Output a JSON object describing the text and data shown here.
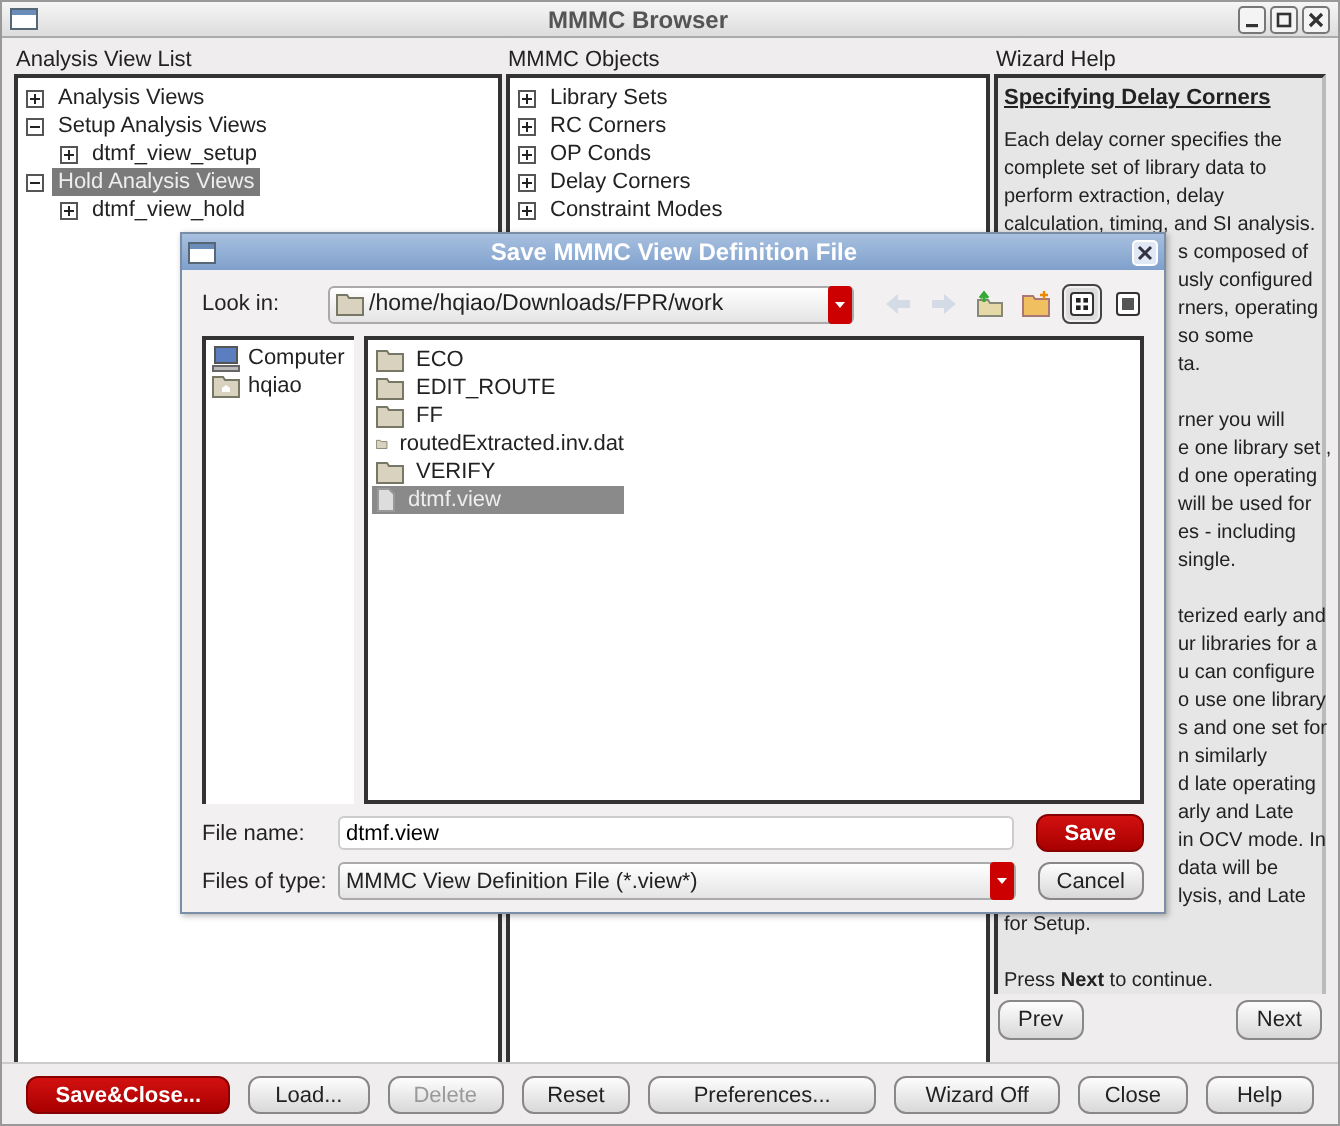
{
  "window": {
    "title": "MMMC Browser"
  },
  "analysis_view_list": {
    "label": "Analysis View List",
    "items": [
      {
        "label": "Analysis Views",
        "expanded": false,
        "selected": false
      },
      {
        "label": "Setup Analysis Views",
        "expanded": true,
        "selected": false,
        "children": [
          {
            "label": "dtmf_view_setup",
            "expanded": false,
            "selected": false
          }
        ]
      },
      {
        "label": "Hold Analysis Views",
        "expanded": true,
        "selected": true,
        "children": [
          {
            "label": "dtmf_view_hold",
            "expanded": false,
            "selected": false
          }
        ]
      }
    ]
  },
  "mmmc_objects": {
    "label": "MMMC Objects",
    "items": [
      {
        "label": "Library Sets",
        "expanded": false
      },
      {
        "label": "RC Corners",
        "expanded": false
      },
      {
        "label": "OP Conds",
        "expanded": false
      },
      {
        "label": "Delay Corners",
        "expanded": false
      },
      {
        "label": "Constraint Modes",
        "expanded": false
      }
    ]
  },
  "wizard_help": {
    "label": "Wizard Help",
    "heading": "Specifying Delay Corners",
    "paragraphs": [
      {
        "lines": [
          {
            "text": "Each delay corner specifies the",
            "kind": "full"
          },
          {
            "text": "complete set of library data to",
            "kind": "full"
          },
          {
            "text": "perform extraction, delay",
            "kind": "full"
          },
          {
            "text": "calculation, timing, and SI analysis.",
            "kind": "full"
          },
          {
            "text": "s composed of",
            "kind": "clipped"
          },
          {
            "text": "usly configured",
            "kind": "clipped"
          },
          {
            "text": "rners, operating",
            "kind": "clipped"
          },
          {
            "text": "so some",
            "kind": "clipped"
          },
          {
            "text": "ta.",
            "kind": "clipped"
          }
        ]
      },
      {
        "lines": [
          {
            "text": "rner you will",
            "kind": "clipped"
          },
          {
            "text": "e one library set ,",
            "kind": "clipped"
          },
          {
            "text": "d one operating",
            "kind": "clipped"
          },
          {
            "text": "will be used for",
            "kind": "clipped"
          },
          {
            "text": "es - including",
            "kind": "clipped"
          },
          {
            "text": "single.",
            "kind": "clipped"
          }
        ]
      },
      {
        "lines": [
          {
            "text": "terized early and",
            "kind": "clipped"
          },
          {
            "text": "ur libraries for a",
            "kind": "clipped"
          },
          {
            "text": "u can configure",
            "kind": "clipped"
          },
          {
            "text": "o use one library",
            "kind": "clipped"
          },
          {
            "text": "s and one set for",
            "kind": "clipped"
          },
          {
            "text": "n similarly",
            "kind": "clipped"
          },
          {
            "text": "d late operating",
            "kind": "clipped"
          },
          {
            "text": "arly and Late",
            "kind": "clipped"
          },
          {
            "text": "in OCV mode. In",
            "kind": "clipped"
          },
          {
            "text": "data will be",
            "kind": "clipped"
          },
          {
            "text": "lysis, and Late",
            "kind": "clipped"
          },
          {
            "text": "for Setup.",
            "kind": "full"
          }
        ]
      },
      {
        "lines": [
          {
            "text": "Press **Next** to continue.",
            "kind": "full"
          }
        ]
      }
    ],
    "nav_buttons": [
      "Prev",
      "Next"
    ]
  },
  "buttons": [
    {
      "label": "Save&Close...",
      "primary": true,
      "disabled": false
    },
    {
      "label": "Load...",
      "primary": false,
      "disabled": false
    },
    {
      "label": "Delete",
      "primary": false,
      "disabled": true
    },
    {
      "label": "Reset",
      "primary": false,
      "disabled": false
    },
    {
      "label": "Preferences...",
      "primary": false,
      "disabled": false
    },
    {
      "label": "Wizard Off",
      "primary": false,
      "disabled": false
    },
    {
      "label": "Close",
      "primary": false,
      "disabled": false
    },
    {
      "label": "Help",
      "primary": false,
      "disabled": false
    }
  ],
  "dialog": {
    "title": "Save MMMC View Definition File",
    "look_in_label": "Look in:",
    "look_in_value": "/home/hqiao/Downloads/FPR/work",
    "toolbar": [
      {
        "kind": "back",
        "disabled": true,
        "selected": false
      },
      {
        "kind": "forward",
        "disabled": true,
        "selected": false
      },
      {
        "kind": "up",
        "disabled": false,
        "selected": false
      },
      {
        "kind": "new-folder",
        "disabled": false,
        "selected": false
      },
      {
        "kind": "icon-view",
        "disabled": false,
        "selected": true
      },
      {
        "kind": "detail-view",
        "disabled": false,
        "selected": false
      }
    ],
    "places": [
      {
        "label": "Computer",
        "kind": "computer"
      },
      {
        "label": "hqiao",
        "kind": "home"
      }
    ],
    "files": [
      {
        "name": "ECO",
        "kind": "folder",
        "selected": false
      },
      {
        "name": "EDIT_ROUTE",
        "kind": "folder",
        "selected": false
      },
      {
        "name": "FF",
        "kind": "folder",
        "selected": false
      },
      {
        "name": "routedExtracted.inv.dat",
        "kind": "folder",
        "selected": false
      },
      {
        "name": "VERIFY",
        "kind": "folder",
        "selected": false
      },
      {
        "name": "dtmf.view",
        "kind": "file",
        "selected": true
      }
    ],
    "file_name_label": "File name:",
    "file_name_value": "dtmf.view",
    "files_of_type_label": "Files of type:",
    "files_of_type_value": "MMMC View Definition File (*.view*)",
    "save_button": "Save",
    "cancel_button": "Cancel"
  }
}
